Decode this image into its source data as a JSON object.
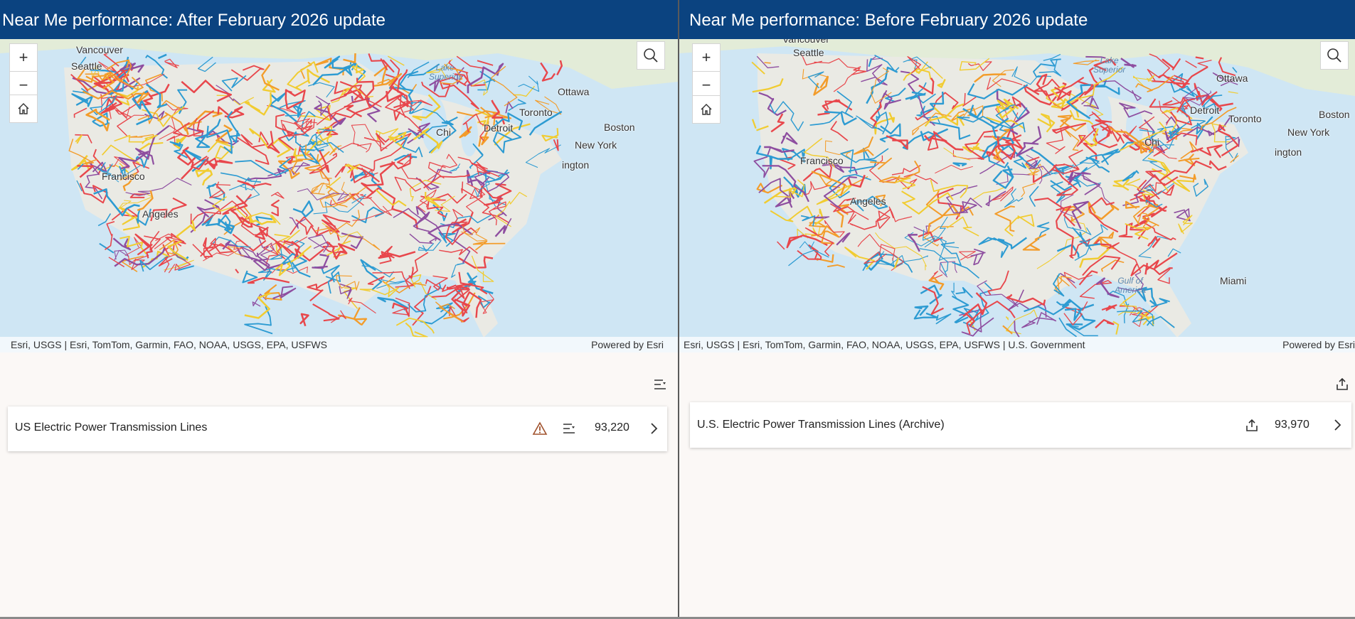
{
  "left_panel": {
    "title": "Near Me performance: After February 2026 update",
    "map": {
      "zoom_in_label": "+",
      "zoom_out_label": "−",
      "cities": [
        "Vancouver",
        "Seattle",
        "Francisco",
        "Angeles",
        "Ottawa",
        "Toronto",
        "Detroit",
        "Chi",
        "Boston",
        "New York",
        "ington"
      ],
      "water": [
        "Lake",
        "Superior"
      ],
      "attribution": "Esri, USGS | Esri, TomTom, Garmin, FAO, NOAA, USGS, EPA, USFWS",
      "powered_by": "Powered by Esri"
    },
    "card": {
      "layer_name": "US Electric Power Transmission Lines",
      "count": "93,220"
    }
  },
  "right_panel": {
    "title": "Near Me performance: Before February 2026 update",
    "map": {
      "zoom_in_label": "+",
      "zoom_out_label": "−",
      "cities": [
        "Vancouver",
        "Seattle",
        "Francisco",
        "Angeles",
        "Ottawa",
        "Toronto",
        "Detroit",
        "Chi",
        "Boston",
        "New York",
        "ington",
        "Miami"
      ],
      "water": [
        "Lake",
        "Superior",
        "Gulf of",
        "America"
      ],
      "attribution": "Esri, USGS | Esri, TomTom, Garmin, FAO, NOAA, USGS, EPA, USFWS | U.S. Government",
      "powered_by": "Powered by Esri"
    },
    "card": {
      "layer_name": "U.S. Electric Power Transmission Lines (Archive)",
      "count": "93,970"
    }
  },
  "icons": {
    "search": "search-icon",
    "home": "home-icon",
    "warning": "warning-icon",
    "filter": "filter-icon",
    "export": "export-icon",
    "chevron": "chevron-right-icon"
  },
  "colors": {
    "title_bar": "#0b4380",
    "line_red": "#e8474c",
    "line_blue": "#2d9bd2",
    "line_orange": "#f39c2a",
    "line_purple": "#8e4ea0",
    "line_yellow": "#f1cc31",
    "warning": "#a0522d"
  }
}
